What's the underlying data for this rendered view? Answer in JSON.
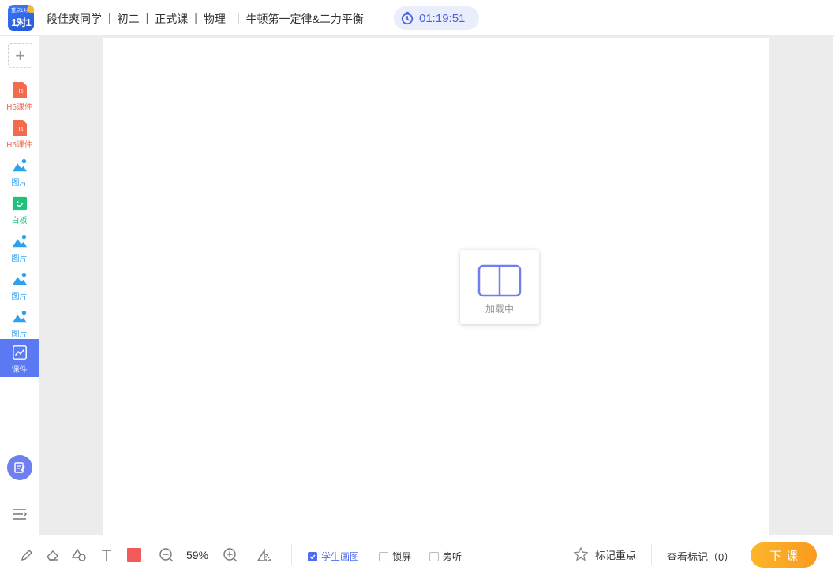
{
  "header": {
    "logo_small_text": "重点1对1",
    "logo_text": "1对1",
    "student": "段佳爽同学",
    "grade": "初二",
    "course_type": "正式课",
    "subject": "物理",
    "lesson": "牛顿第一定律&二力平衡",
    "timer": "01:19:51"
  },
  "sidebar": {
    "add_label": "+",
    "items": [
      {
        "label": "H5课件",
        "icon": "h5-file-icon",
        "color": "#f26b4f"
      },
      {
        "label": "H5课件",
        "icon": "h5-file-icon",
        "color": "#f26b4f"
      },
      {
        "label": "图片",
        "icon": "image-icon",
        "color": "#2ea0f2"
      },
      {
        "label": "白板",
        "icon": "whiteboard-icon",
        "color": "#1fc27a"
      },
      {
        "label": "图片",
        "icon": "image-icon",
        "color": "#2ea0f2"
      },
      {
        "label": "图片",
        "icon": "image-icon",
        "color": "#2ea0f2"
      },
      {
        "label": "图片",
        "icon": "image-icon",
        "color": "#2ea0f2"
      },
      {
        "label": "课件",
        "icon": "courseware-icon",
        "active": true
      }
    ]
  },
  "main": {
    "loading_text": "加载中"
  },
  "toolbar": {
    "zoom": "59%",
    "pen_color": "#f05a5a",
    "student_draw_label": "学生画图",
    "student_draw_checked": true,
    "lock_screen_label": "锁屏",
    "lock_screen_checked": false,
    "audit_label": "旁听",
    "audit_checked": false,
    "mark_key_label": "标记重点",
    "view_marks_label": "查看标记（0）",
    "end_class_label": "下课"
  }
}
